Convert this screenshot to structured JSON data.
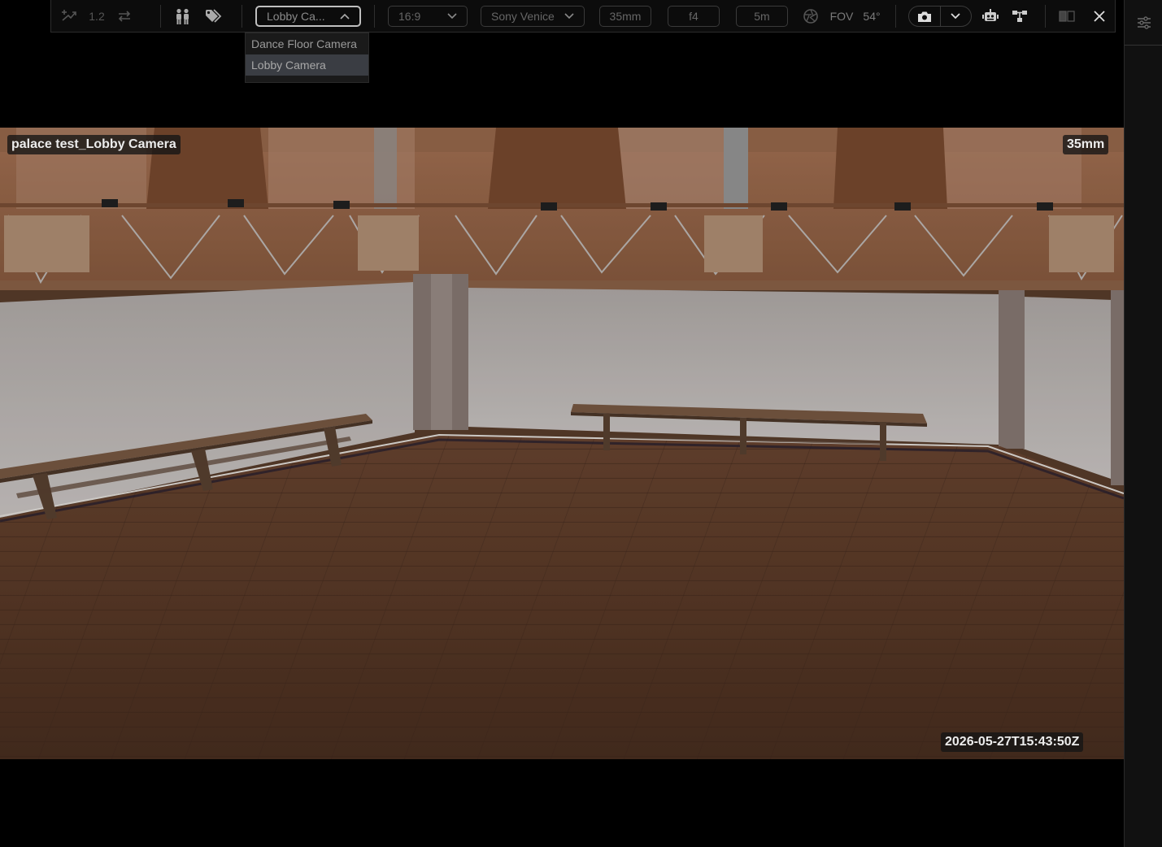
{
  "toolbar": {
    "version_label": "1.2",
    "camera_select_value": "Lobby Ca...",
    "aspect_ratio": "16:9",
    "camera_body": "Sony Venice",
    "focal_length": "35mm",
    "aperture": "f4",
    "focus_distance": "5m",
    "fov_label": "FOV",
    "fov_value": "54°"
  },
  "camera_dropdown": {
    "options": [
      "Dance Floor Camera",
      "Lobby Camera"
    ],
    "selected": "Lobby Camera"
  },
  "viewport": {
    "scene_label": "palace test_Lobby Camera",
    "lens_label": "35mm",
    "timestamp": "2026-05-27T15:43:50Z"
  },
  "colors": {
    "toolbar_bg": "#0c0c0c",
    "dropdown_selected": "#3a3d43",
    "floor_wood": "#6a4630",
    "wall_white": "#c8c4c2"
  },
  "icons": {
    "left_group": [
      "drone-icon",
      "swap-icon"
    ],
    "people_group": [
      "people-icon",
      "tags-icon"
    ],
    "camera_group": [
      "aperture-icon",
      "camera-icon",
      "chevron-down-icon",
      "robot-icon",
      "node-graph-icon",
      "split-view-icon",
      "close-icon"
    ],
    "rail": [
      "sliders-icon"
    ]
  }
}
